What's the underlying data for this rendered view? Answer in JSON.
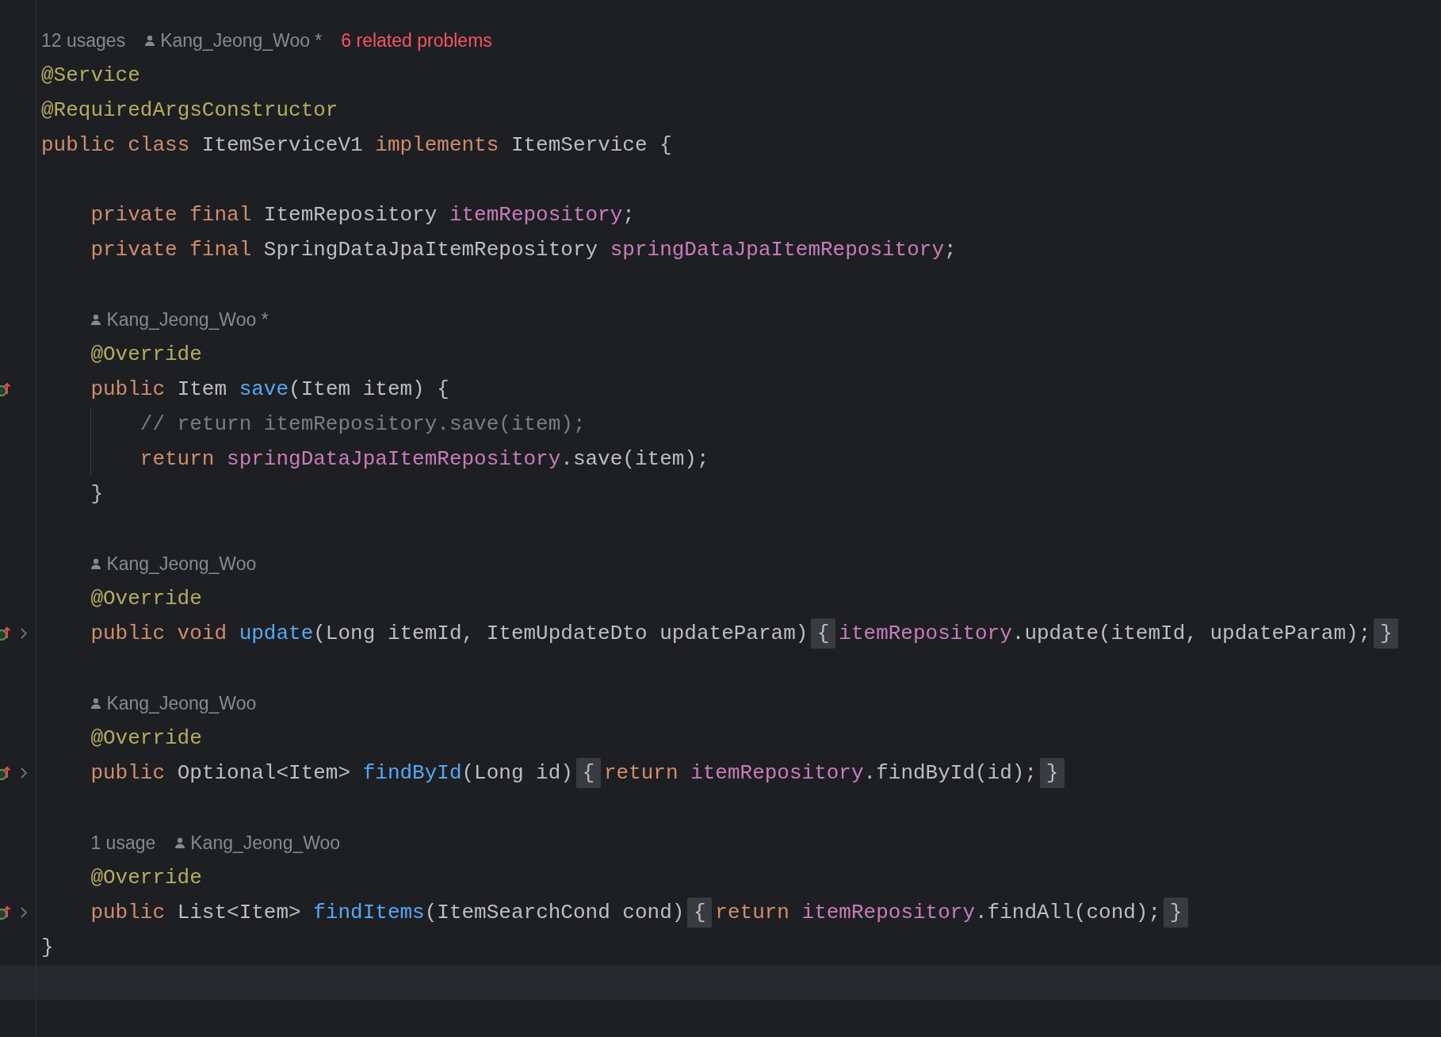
{
  "editor": {
    "lines": [
      {
        "kind": "hints",
        "hints": [
          {
            "kind": "usages",
            "text": "12 usages"
          },
          {
            "kind": "author",
            "text": "Kang_Jeong_Woo *"
          },
          {
            "kind": "problems",
            "text": "6 related problems"
          }
        ]
      },
      {
        "kind": "code",
        "tokens": [
          {
            "kind": "annotation",
            "text": "@Service"
          }
        ]
      },
      {
        "kind": "code",
        "tokens": [
          {
            "kind": "annotation",
            "text": "@RequiredArgsConstructor"
          }
        ]
      },
      {
        "kind": "code",
        "tokens": [
          {
            "kind": "keyword",
            "text": "public class"
          },
          {
            "kind": "plain",
            "text": " ItemServiceV1 "
          },
          {
            "kind": "keyword",
            "text": "implements"
          },
          {
            "kind": "plain",
            "text": " ItemService {"
          }
        ],
        "children": [
          {
            "kind": "blank"
          },
          {
            "kind": "code",
            "tokens": [
              {
                "kind": "keyword",
                "text": "private final"
              },
              {
                "kind": "plain",
                "text": " ItemRepository "
              },
              {
                "kind": "field",
                "text": "itemRepository"
              },
              {
                "kind": "plain",
                "text": ";"
              }
            ]
          },
          {
            "kind": "code",
            "tokens": [
              {
                "kind": "keyword",
                "text": "private final"
              },
              {
                "kind": "plain",
                "text": " SpringDataJpaItemRepository "
              },
              {
                "kind": "field",
                "text": "springDataJpaItemRepository"
              },
              {
                "kind": "plain",
                "text": ";"
              }
            ]
          },
          {
            "kind": "blank"
          },
          {
            "kind": "hints",
            "hints": [
              {
                "kind": "author",
                "text": "Kang_Jeong_Woo *"
              }
            ]
          },
          {
            "kind": "code",
            "tokens": [
              {
                "kind": "annotation",
                "text": "@Override"
              }
            ]
          },
          {
            "kind": "code",
            "implements": true,
            "tokens": [
              {
                "kind": "keyword",
                "text": "public"
              },
              {
                "kind": "plain",
                "text": " Item "
              },
              {
                "kind": "method",
                "text": "save"
              },
              {
                "kind": "plain",
                "text": "(Item item) {"
              }
            ],
            "children": [
              {
                "kind": "code",
                "tokens": [
                  {
                    "kind": "comment",
                    "text": "// return itemRepository.save(item);"
                  }
                ]
              },
              {
                "kind": "code",
                "tokens": [
                  {
                    "kind": "keyword",
                    "text": "return "
                  },
                  {
                    "kind": "field",
                    "text": "springDataJpaItemRepository"
                  },
                  {
                    "kind": "plain",
                    "text": ".save(item);"
                  }
                ]
              }
            ]
          },
          {
            "kind": "code",
            "tokens": [
              {
                "kind": "plain",
                "text": "}"
              }
            ]
          },
          {
            "kind": "blank"
          },
          {
            "kind": "hints",
            "hints": [
              {
                "kind": "author",
                "text": "Kang_Jeong_Woo"
              }
            ]
          },
          {
            "kind": "code",
            "tokens": [
              {
                "kind": "annotation",
                "text": "@Override"
              }
            ]
          },
          {
            "kind": "code",
            "implements": true,
            "foldable": true,
            "tokens": [
              {
                "kind": "keyword",
                "text": "public void "
              },
              {
                "kind": "method",
                "text": "update"
              },
              {
                "kind": "plain",
                "text": "(Long itemId, ItemUpdateDto updateParam)"
              },
              {
                "kind": "fold",
                "text": "{"
              },
              {
                "kind": "field",
                "text": "itemRepository"
              },
              {
                "kind": "plain",
                "text": ".update(itemId, updateParam);"
              },
              {
                "kind": "fold",
                "text": "}"
              }
            ]
          },
          {
            "kind": "blank"
          },
          {
            "kind": "hints",
            "hints": [
              {
                "kind": "author",
                "text": "Kang_Jeong_Woo"
              }
            ]
          },
          {
            "kind": "code",
            "tokens": [
              {
                "kind": "annotation",
                "text": "@Override"
              }
            ]
          },
          {
            "kind": "code",
            "implements": true,
            "foldable": true,
            "tokens": [
              {
                "kind": "keyword",
                "text": "public"
              },
              {
                "kind": "plain",
                "text": " Optional<Item> "
              },
              {
                "kind": "method",
                "text": "findById"
              },
              {
                "kind": "plain",
                "text": "(Long id)"
              },
              {
                "kind": "fold",
                "text": "{"
              },
              {
                "kind": "keyword",
                "text": "return "
              },
              {
                "kind": "field",
                "text": "itemRepository"
              },
              {
                "kind": "plain",
                "text": ".findById(id);"
              },
              {
                "kind": "fold",
                "text": "}"
              }
            ]
          },
          {
            "kind": "blank"
          },
          {
            "kind": "hints",
            "hints": [
              {
                "kind": "usages",
                "text": "1 usage"
              },
              {
                "kind": "author",
                "text": "Kang_Jeong_Woo"
              }
            ]
          },
          {
            "kind": "code",
            "tokens": [
              {
                "kind": "annotation",
                "text": "@Override"
              }
            ]
          },
          {
            "kind": "code",
            "implements": true,
            "foldable": true,
            "tokens": [
              {
                "kind": "keyword",
                "text": "public"
              },
              {
                "kind": "plain",
                "text": " List<Item> "
              },
              {
                "kind": "method",
                "text": "findItems"
              },
              {
                "kind": "plain",
                "text": "(ItemSearchCond cond)"
              },
              {
                "kind": "fold",
                "text": "{"
              },
              {
                "kind": "keyword",
                "text": "return "
              },
              {
                "kind": "field",
                "text": "itemRepository"
              },
              {
                "kind": "plain",
                "text": ".findAll(cond);"
              },
              {
                "kind": "fold",
                "text": "}"
              }
            ]
          }
        ]
      },
      {
        "kind": "code",
        "tokens": [
          {
            "kind": "plain",
            "text": "}"
          }
        ]
      },
      {
        "kind": "blank",
        "current": true
      }
    ]
  }
}
